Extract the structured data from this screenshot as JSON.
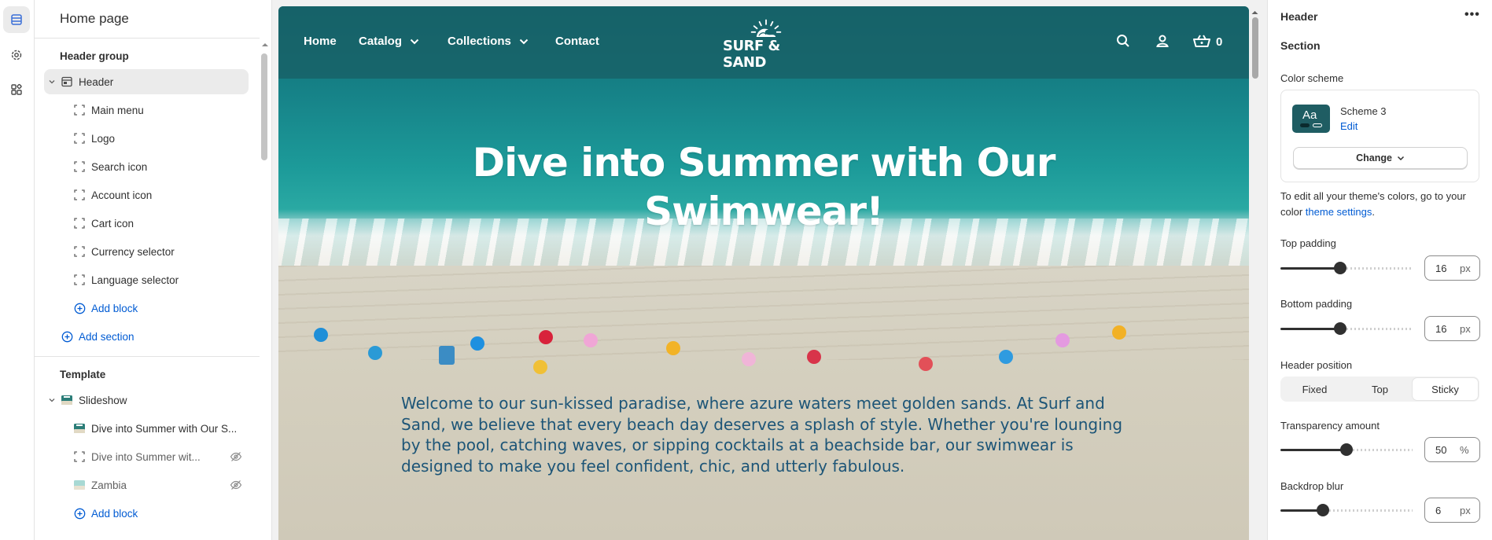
{
  "left_panel": {
    "title": "Home page",
    "header_group_label": "Header group",
    "header_section": "Header",
    "header_blocks": [
      "Main menu",
      "Logo",
      "Search icon",
      "Account icon",
      "Cart icon",
      "Currency selector",
      "Language selector"
    ],
    "add_block": "Add block",
    "add_section": "Add section",
    "template_label": "Template",
    "slideshow_section": "Slideshow",
    "slideshow_blocks": [
      "Dive into Summer with Our S...",
      "Dive into Summer wit...",
      "Zambia"
    ],
    "add_block_2": "Add block"
  },
  "preview": {
    "nav": {
      "home": "Home",
      "catalog": "Catalog",
      "collections": "Collections",
      "contact": "Contact",
      "cart_count": "0"
    },
    "logo_text": "SURF & SAND",
    "hero_title": "Dive into Summer with Our Swimwear!",
    "hero_body": "Welcome to our sun-kissed paradise, where azure waters meet golden sands. At Surf and Sand, we believe that every beach day deserves a splash of style. Whether you're lounging by the pool, catching waves, or sipping cocktails at a beachside bar, our swimwear is designed to make you feel confident, chic, and utterly fabulous."
  },
  "right_panel": {
    "title": "Header",
    "more": "•••",
    "section_label": "Section",
    "color_scheme_label": "Color scheme",
    "swatch_text": "Aa",
    "scheme_name": "Scheme 3",
    "scheme_edit": "Edit",
    "change_button": "Change",
    "help_text": "To edit all your theme's colors, go to your color ",
    "help_link": "theme settings",
    "help_end": ".",
    "top_padding": {
      "label": "Top padding",
      "value": "16",
      "unit": "px",
      "fraction": 0.45
    },
    "bottom_padding": {
      "label": "Bottom padding",
      "value": "16",
      "unit": "px",
      "fraction": 0.45
    },
    "header_position": {
      "label": "Header position",
      "options": [
        "Fixed",
        "Top",
        "Sticky"
      ],
      "selected": "Sticky"
    },
    "transparency": {
      "label": "Transparency amount",
      "value": "50",
      "unit": "%",
      "fraction": 0.5
    },
    "backdrop_blur": {
      "label": "Backdrop blur",
      "value": "6",
      "unit": "px",
      "fraction": 0.3
    }
  },
  "colors": {
    "accent_link": "#005bd3",
    "nav_bg": "#186066",
    "hero_text": "#1d5577"
  }
}
